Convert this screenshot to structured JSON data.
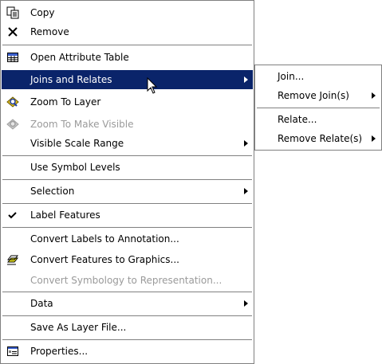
{
  "main_menu": {
    "copy": "Copy",
    "remove": "Remove",
    "open_attribute_table": "Open Attribute Table",
    "joins_and_relates": "Joins and Relates",
    "zoom_to_layer": "Zoom To Layer",
    "zoom_to_make_visible": "Zoom To Make Visible",
    "visible_scale_range": "Visible Scale Range",
    "use_symbol_levels": "Use Symbol Levels",
    "selection": "Selection",
    "label_features": "Label Features",
    "convert_labels": "Convert Labels to Annotation...",
    "convert_features": "Convert Features to Graphics...",
    "convert_symbology": "Convert Symbology to Representation...",
    "data": "Data",
    "save_as_layer_file": "Save As Layer File...",
    "properties": "Properties..."
  },
  "submenu": {
    "join": "Join...",
    "remove_joins": "Remove Join(s)",
    "relate": "Relate...",
    "remove_relates": "Remove Relate(s)"
  },
  "colors": {
    "highlight": "#0a246a",
    "disabled": "#9a9a9a",
    "border": "#808080"
  },
  "icons": {
    "copy": "copy-icon",
    "remove": "remove-x-icon",
    "table": "table-icon",
    "zoom": "zoom-to-layer-icon",
    "check": "checkmark-icon",
    "graphics": "convert-graphics-icon",
    "properties": "properties-icon"
  }
}
